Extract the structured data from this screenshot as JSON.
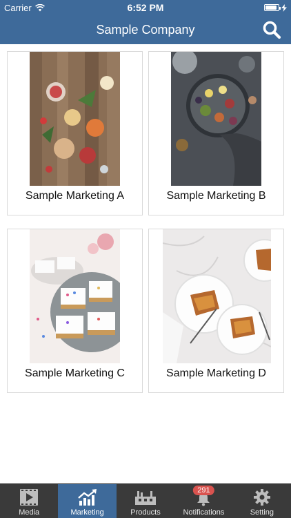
{
  "status_bar": {
    "carrier": "Carrier",
    "time": "6:52 PM",
    "battery_level": 0.9
  },
  "header": {
    "title": "Sample Company",
    "search_icon": "search-icon"
  },
  "items": [
    {
      "label": "Sample Marketing A",
      "image": "cocktails-photo"
    },
    {
      "label": "Sample Marketing B",
      "image": "platter-photo"
    },
    {
      "label": "Sample Marketing C",
      "image": "cake-bars-photo"
    },
    {
      "label": "Sample Marketing D",
      "image": "tart-plates-photo"
    }
  ],
  "tabs": [
    {
      "label": "Media",
      "icon": "video-icon",
      "active": false
    },
    {
      "label": "Marketing",
      "icon": "trend-chart-icon",
      "active": true
    },
    {
      "label": "Products",
      "icon": "factory-icon",
      "active": false
    },
    {
      "label": "Notifications",
      "icon": "bell-icon",
      "active": false,
      "badge": "291"
    },
    {
      "label": "Setting",
      "icon": "gear-icon",
      "active": false
    }
  ],
  "colors": {
    "brand": "#3e6a9a",
    "tab_bar": "#3a3a3a",
    "badge": "#d9534f"
  }
}
